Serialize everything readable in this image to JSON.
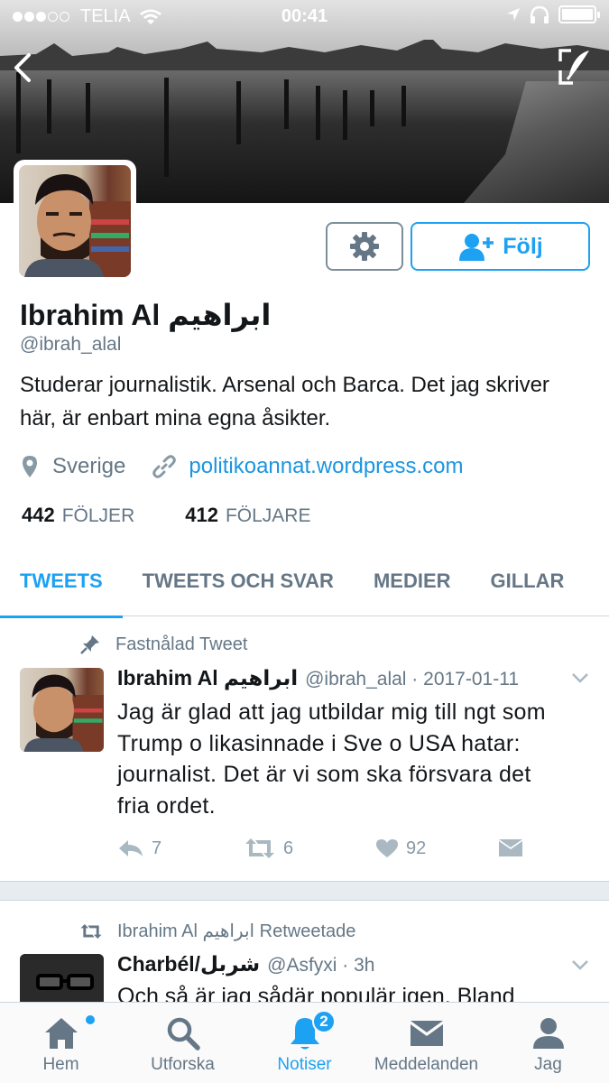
{
  "status_bar": {
    "carrier": "TELIA",
    "time": "00:41",
    "signal_bars_filled": 3,
    "signal_bars_total": 5,
    "battery_level": 1.0
  },
  "header": {
    "back_icon": "chevron-left-icon",
    "compose_icon": "compose-quill-icon"
  },
  "profile": {
    "name": "Ibrahim Al ابراهيم",
    "handle": "@ibrah_alal",
    "bio": "Studerar journalistik. Arsenal och Barca. Det jag skriver här, är enbart mina egna åsikter.",
    "location": "Sverige",
    "website": "politikoannat.wordpress.com",
    "following_count": "442",
    "following_label": "FÖLJER",
    "followers_count": "412",
    "followers_label": "FÖLJARE",
    "follow_button_label": "Följ"
  },
  "tabs": [
    {
      "label": "TWEETS",
      "active": true
    },
    {
      "label": "TWEETS OCH SVAR",
      "active": false
    },
    {
      "label": "MEDIER",
      "active": false
    },
    {
      "label": "GILLAR",
      "active": false
    }
  ],
  "tweets": [
    {
      "context_label": "Fastnålad Tweet",
      "author_name": "Ibrahim Al ابراهيم",
      "author_handle": "@ibrah_alal · 2017-01-11",
      "text": "Jag är glad att jag utbildar mig till ngt som Trump o likasinnade i Sve o USA hatar: journalist. Det är vi som ska försvara det fria ordet.",
      "replies": "7",
      "retweets": "6",
      "likes": "92"
    },
    {
      "context_label": "Ibrahim Al ابراهيم Retweetade",
      "author_name": "Charbél/شربل",
      "author_handle": "@Asfyxi · 3h",
      "text": "Och så är jag sådär populär igen. Bland"
    }
  ],
  "bottom_nav": [
    {
      "label": "Hem",
      "icon": "home-icon",
      "active": false
    },
    {
      "label": "Utforska",
      "icon": "search-icon",
      "active": false
    },
    {
      "label": "Notiser",
      "icon": "bell-icon",
      "active": true,
      "badge": "2"
    },
    {
      "label": "Meddelanden",
      "icon": "envelope-icon",
      "active": false
    },
    {
      "label": "Jag",
      "icon": "person-icon",
      "active": false
    }
  ],
  "colors": {
    "accent": "#1da1f2",
    "muted": "#657786",
    "text": "#14171a"
  }
}
